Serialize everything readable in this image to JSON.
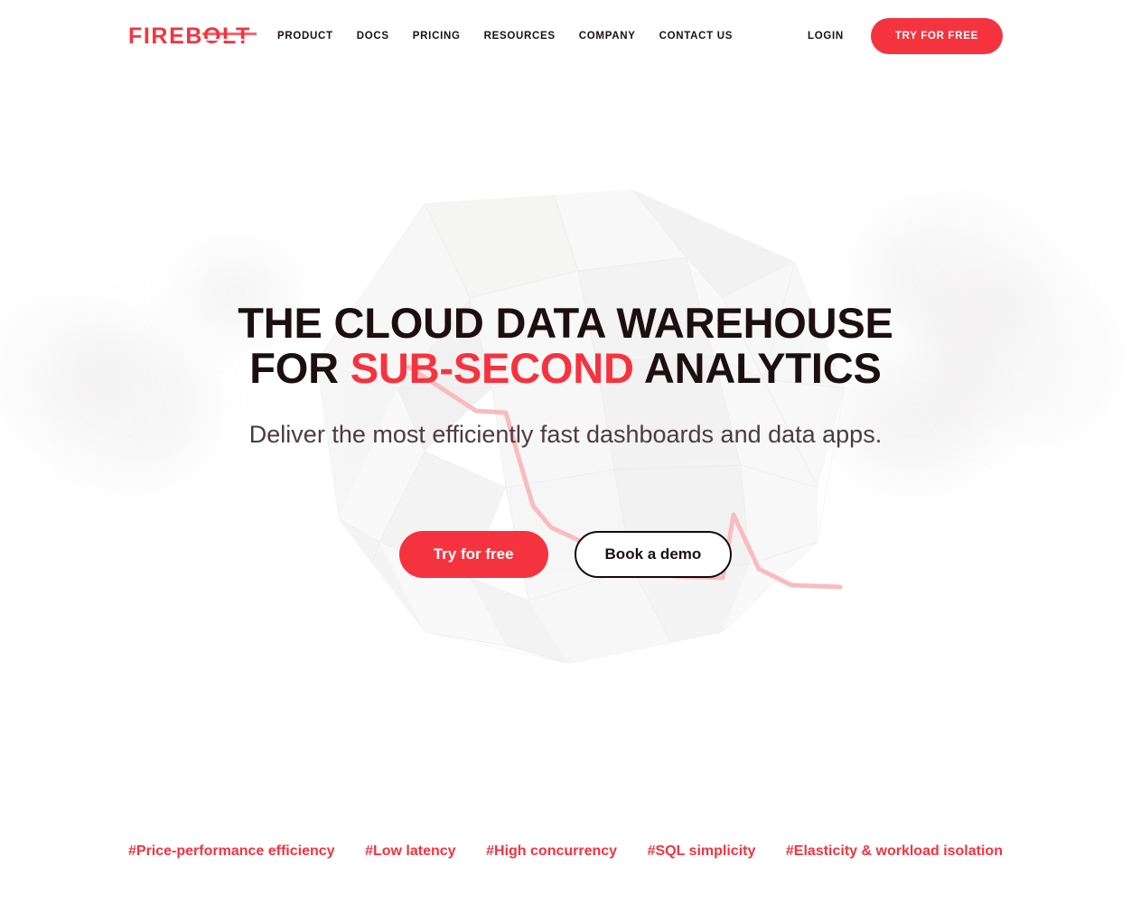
{
  "brand": {
    "logo_text": "FIREBOLT",
    "accent_color": "#f5333f",
    "text_color": "#1c0f12"
  },
  "header": {
    "nav_items": [
      {
        "label": "PRODUCT",
        "name": "product"
      },
      {
        "label": "DOCS",
        "name": "docs"
      },
      {
        "label": "PRICING",
        "name": "pricing"
      },
      {
        "label": "RESOURCES",
        "name": "resources"
      },
      {
        "label": "COMPANY",
        "name": "company"
      },
      {
        "label": "CONTACT US",
        "name": "contact-us"
      }
    ],
    "login_label": "LOGIN",
    "cta_label": "TRY FOR FREE"
  },
  "hero": {
    "headline_line1": "THE CLOUD DATA WAREHOUSE",
    "headline_line2_pre": "FOR ",
    "headline_line2_accent": "SUB-SECOND",
    "headline_line2_post": " ANALYTICS",
    "subhead": "Deliver the most efficiently fast dashboards and data apps.",
    "primary_cta": "Try for free",
    "secondary_cta": "Book a demo"
  },
  "tags": [
    {
      "label": "#Price-performance efficiency",
      "name": "price-performance-efficiency"
    },
    {
      "label": "#Low latency",
      "name": "low-latency"
    },
    {
      "label": "#High concurrency",
      "name": "high-concurrency"
    },
    {
      "label": "#SQL simplicity",
      "name": "sql-simplicity"
    },
    {
      "label": "#Elasticity & workload isolation",
      "name": "elasticity-workload-isolation"
    }
  ]
}
